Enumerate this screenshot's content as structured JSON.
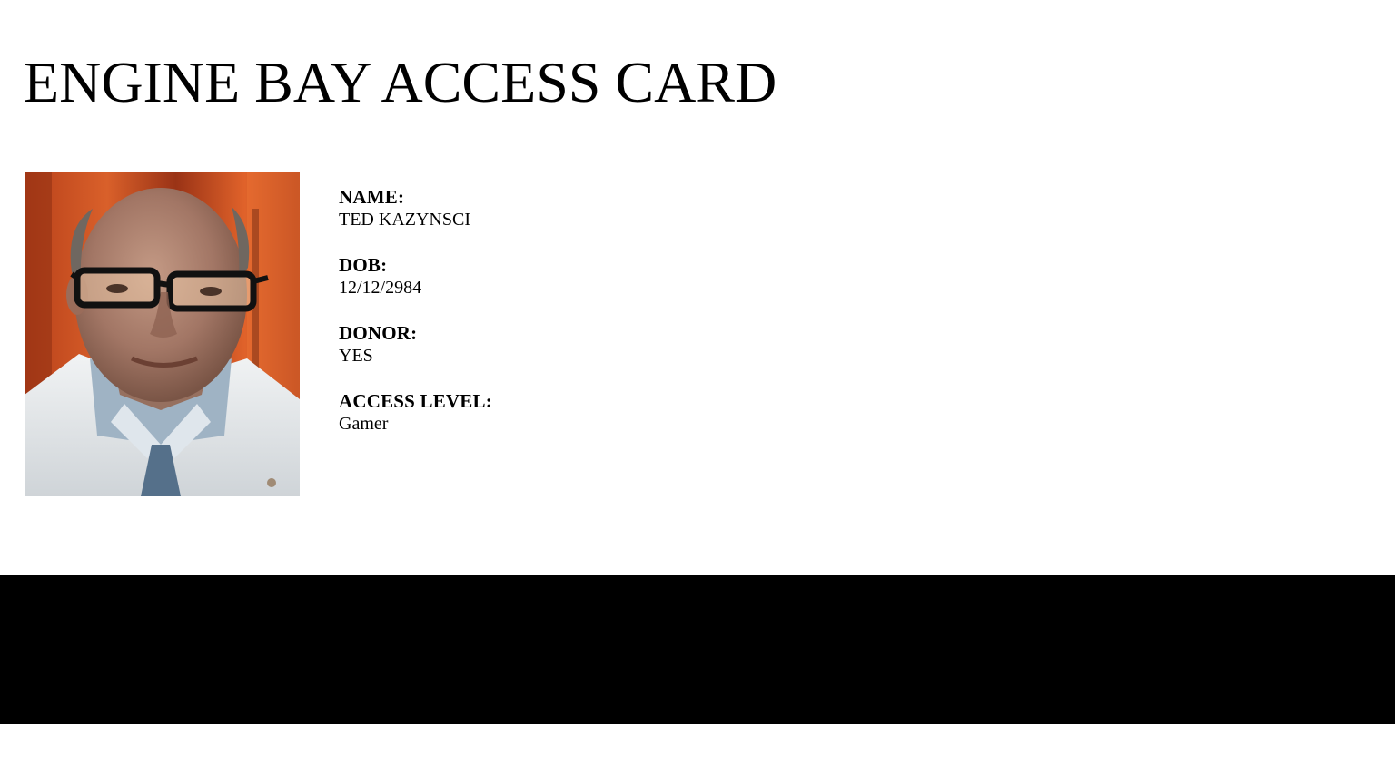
{
  "card": {
    "title": "ENGINE BAY ACCESS CARD",
    "fields": [
      {
        "label": "NAME:",
        "value": "TED KAZYNSCI"
      },
      {
        "label": "DOB:",
        "value": "12/12/2984"
      },
      {
        "label": "DONOR:",
        "value": "YES"
      },
      {
        "label": "ACCESS LEVEL:",
        "value": "Gamer"
      }
    ]
  },
  "colors": {
    "background": "#ffffff",
    "text": "#000000",
    "footer_band": "#000000",
    "photo_background": "#c0451c"
  }
}
